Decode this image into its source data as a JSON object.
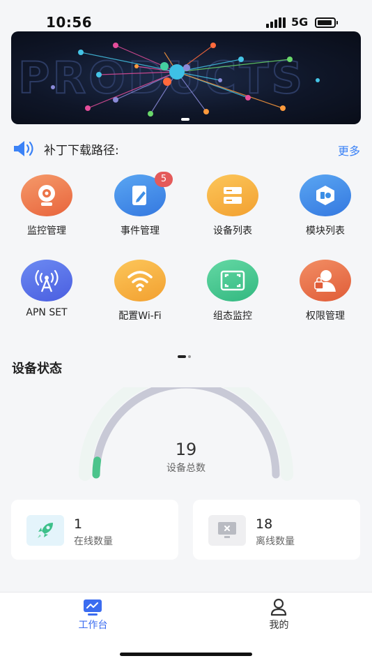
{
  "status_bar": {
    "time": "10:56",
    "network": "5G"
  },
  "banner": {
    "watermark_text": "PRODUCTS"
  },
  "notice": {
    "text": "补丁下载路径:",
    "more_label": "更多"
  },
  "grid": [
    {
      "label": "监控管理",
      "icon": "camera-icon",
      "color": "#ee7a4e"
    },
    {
      "label": "事件管理",
      "icon": "edit-book-icon",
      "color": "#3f8fe6",
      "badge": "5"
    },
    {
      "label": "设备列表",
      "icon": "server-list-icon",
      "color": "#f5ae3c"
    },
    {
      "label": "模块列表",
      "icon": "cube-icon",
      "color": "#3b8ee6"
    },
    {
      "label": "APN SET",
      "icon": "antenna-icon",
      "color": "#4e6ee8"
    },
    {
      "label": "配置Wi-Fi",
      "icon": "wifi-icon",
      "color": "#f5ae3c"
    },
    {
      "label": "组态监控",
      "icon": "scan-frame-icon",
      "color": "#3fc48e"
    },
    {
      "label": "权限管理",
      "icon": "user-lock-icon",
      "color": "#ee7048"
    }
  ],
  "device_status": {
    "title": "设备状态",
    "total": "19",
    "total_label": "设备总数",
    "online": {
      "value": "1",
      "label": "在线数量",
      "icon": "rocket-icon",
      "fraction": 0.05
    },
    "offline": {
      "value": "18",
      "label": "离线数量",
      "icon": "monitor-offline-icon"
    }
  },
  "tabs": [
    {
      "label": "工作台",
      "icon": "dashboard-icon",
      "active": true,
      "color": "#3b6cf0"
    },
    {
      "label": "我的",
      "icon": "profile-icon",
      "active": false,
      "color": "#333333"
    }
  ]
}
